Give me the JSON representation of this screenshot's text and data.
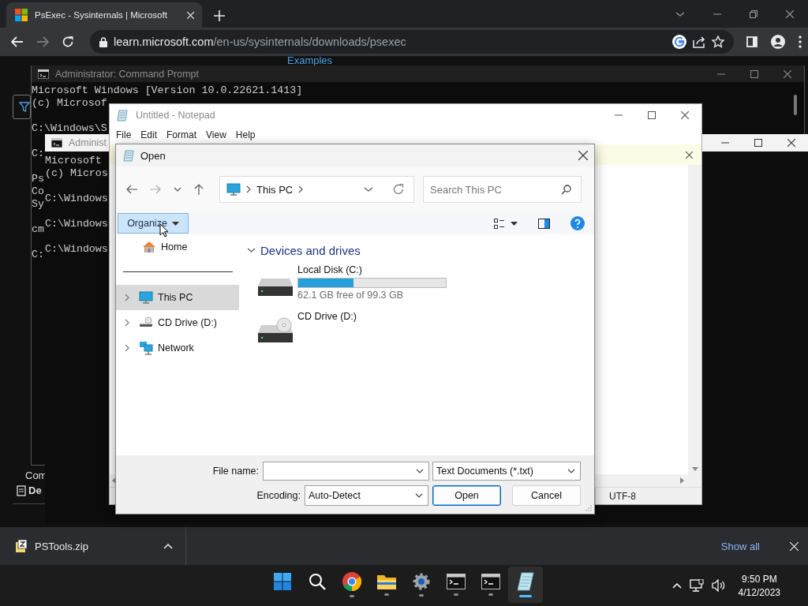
{
  "browser": {
    "tab": {
      "title": "PsExec - Sysinternals | Microsoft"
    },
    "address": {
      "host": "learn.microsoft.com",
      "path": "/en-us/sysinternals/downloads/psexec"
    },
    "page": {
      "heading": "Examples",
      "side_texts": [
        {
          "text": "Com",
          "kind": "plain"
        },
        {
          "text": "De",
          "kind": "document"
        }
      ]
    }
  },
  "command_prompts": [
    {
      "title": "Administrator:  Command Prompt",
      "blocks": [
        [
          "Microsoft Windows [Version 10.0.22621.1413]",
          "(c) Microsof"
        ],
        [
          "C:\\Windows\\S"
        ],
        [
          "C:"
        ],
        [
          "Ps",
          "Co",
          "Sy"
        ],
        [
          "cm"
        ],
        [
          "C:"
        ]
      ]
    },
    {
      "title": "Administ",
      "blocks": [
        [
          "Microsoft",
          "(c) Micros"
        ],
        [
          "C:\\Windows"
        ],
        [
          "C:\\Windows"
        ],
        [
          "C:\\Windows"
        ]
      ]
    }
  ],
  "notepad": {
    "title": "Untitled - Notepad",
    "menu": [
      "File",
      "Edit",
      "Format",
      "View",
      "Help"
    ],
    "encoding": "UTF-8"
  },
  "open_dialog": {
    "title": "Open",
    "address": {
      "segments": [
        "This PC"
      ]
    },
    "search": {
      "placeholder": "Search This PC"
    },
    "organize": "Organize",
    "quick_access": [
      {
        "label": "Home",
        "kind": "home",
        "selected": false
      }
    ],
    "tree": [
      {
        "label": "This PC",
        "kind": "pc",
        "selected": true
      },
      {
        "label": "CD Drive (D:)",
        "kind": "cd",
        "selected": false
      },
      {
        "label": "Network",
        "kind": "network",
        "selected": false
      }
    ],
    "group": {
      "title": "Devices and drives",
      "expanded": true
    },
    "drives": [
      {
        "name": "Local Disk (C:)",
        "kind": "disk",
        "level": 0.375,
        "reading": "62.1 GB free of 99.3 GB"
      },
      {
        "name": "CD Drive (D:)",
        "kind": "cd"
      }
    ],
    "file_name": {
      "label": "File name:"
    },
    "file_type": {
      "value": "Text Documents (*.txt)"
    },
    "encoding": {
      "label": "Encoding:",
      "value": "Auto-Detect"
    },
    "buttons": [
      {
        "label": "Open",
        "default": true
      },
      {
        "label": "Cancel",
        "default": false
      }
    ]
  },
  "download_bar": {
    "file": "PSTools.zip",
    "show_all": "Show all"
  },
  "taskbar": {
    "apps": [
      {
        "kind": "start",
        "running": false,
        "active": false
      },
      {
        "kind": "search",
        "running": false,
        "active": false
      },
      {
        "kind": "chrome",
        "running": true,
        "active": false
      },
      {
        "kind": "explorer",
        "running": true,
        "active": false
      },
      {
        "kind": "settings",
        "running": true,
        "active": false
      },
      {
        "kind": "terminal",
        "running": true,
        "active": false
      },
      {
        "kind": "terminal",
        "running": true,
        "active": false
      },
      {
        "kind": "notepad",
        "running": true,
        "active": true
      }
    ],
    "time": "9:50 PM",
    "date": "4/12/2023"
  }
}
